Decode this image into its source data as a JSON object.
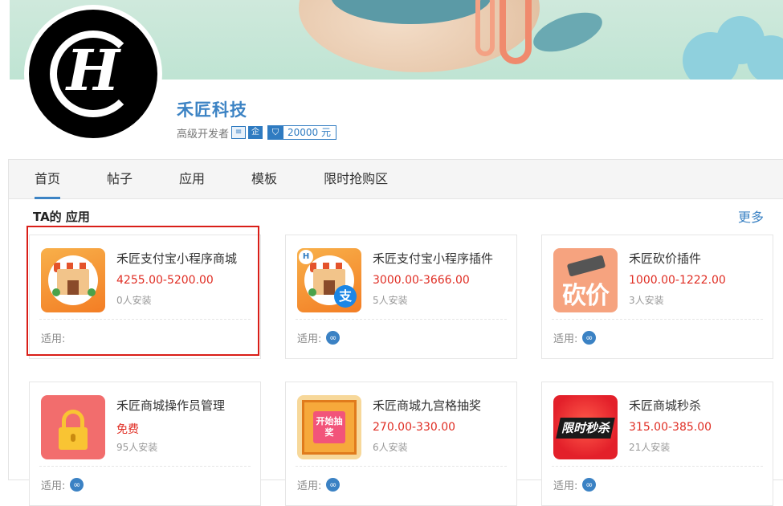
{
  "company": {
    "logo_letter": "H",
    "name": "禾匠科技",
    "level": "高级开发者",
    "badges": [
      "≡",
      "企"
    ],
    "deposit_icon": "shield-icon",
    "deposit": "20000 元"
  },
  "tabs": [
    {
      "label": "首页",
      "active": true
    },
    {
      "label": "帖子"
    },
    {
      "label": "应用"
    },
    {
      "label": "模板"
    },
    {
      "label": "限时抢购区"
    }
  ],
  "section": {
    "title": "TA的 应用",
    "more": "更多"
  },
  "fit_label": "适用:",
  "apps": [
    {
      "name": "禾匠支付宝小程序商城",
      "price": "4255.00-5200.00",
      "installs": "0人安装",
      "icon": "storefront-icon",
      "miniprogram": false
    },
    {
      "name": "禾匠支付宝小程序插件",
      "price": "3000.00-3666.00",
      "installs": "5人安装",
      "icon": "storefront-alipay-icon",
      "miniprogram": true,
      "icon_text": "支"
    },
    {
      "name": "禾匠砍价插件",
      "price": "1000.00-1222.00",
      "installs": "3人安装",
      "icon": "bargain-icon",
      "miniprogram": true,
      "icon_text": "砍价"
    },
    {
      "name": "禾匠商城操作员管理",
      "price": "免费",
      "installs": "95人安装",
      "icon": "lock-icon",
      "miniprogram": true
    },
    {
      "name": "禾匠商城九宫格抽奖",
      "price": "270.00-330.00",
      "installs": "6人安装",
      "icon": "lottery-grid-icon",
      "miniprogram": true,
      "icon_text": "开始抽奖"
    },
    {
      "name": "禾匠商城秒杀",
      "price": "315.00-385.00",
      "installs": "21人安装",
      "icon": "flash-sale-icon",
      "miniprogram": true,
      "icon_text": "限时秒杀"
    }
  ],
  "colors": {
    "accent": "#3c83c4",
    "price": "#e02e24",
    "highlight": "#d91e18"
  }
}
